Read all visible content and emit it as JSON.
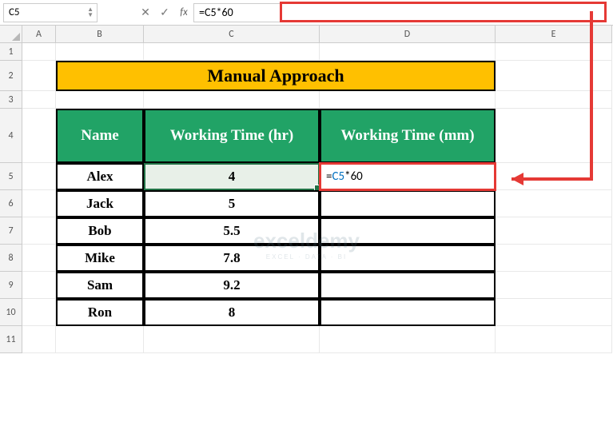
{
  "formula_bar": {
    "cell_ref": "C5",
    "formula": "=C5*60"
  },
  "columns": [
    "A",
    "B",
    "C",
    "D",
    "E"
  ],
  "rows": [
    "1",
    "2",
    "3",
    "4",
    "5",
    "6",
    "7",
    "8",
    "9",
    "10",
    "11"
  ],
  "title": "Manual Approach",
  "headers": {
    "name": "Name",
    "wt_hr": "Working Time (hr)",
    "wt_mm": "Working Time (mm)"
  },
  "table": [
    {
      "name": "Alex",
      "hr": "4"
    },
    {
      "name": "Jack",
      "hr": "5"
    },
    {
      "name": "Bob",
      "hr": "5.5"
    },
    {
      "name": "Mike",
      "hr": "7.8"
    },
    {
      "name": "Sam",
      "hr": "9.2"
    },
    {
      "name": "Ron",
      "hr": "8"
    }
  ],
  "editing": {
    "ref": "C5",
    "rest": "*60",
    "prefix": "="
  },
  "watermark": {
    "logo": "exceldemy",
    "sub": "EXCEL · DATA · BI"
  },
  "chart_data": {
    "type": "table",
    "title": "Manual Approach",
    "columns": [
      "Name",
      "Working Time (hr)",
      "Working Time (mm)"
    ],
    "rows": [
      [
        "Alex",
        4,
        "=C5*60"
      ],
      [
        "Jack",
        5,
        ""
      ],
      [
        "Bob",
        5.5,
        ""
      ],
      [
        "Mike",
        7.8,
        ""
      ],
      [
        "Sam",
        9.2,
        ""
      ],
      [
        "Ron",
        8,
        ""
      ]
    ]
  }
}
